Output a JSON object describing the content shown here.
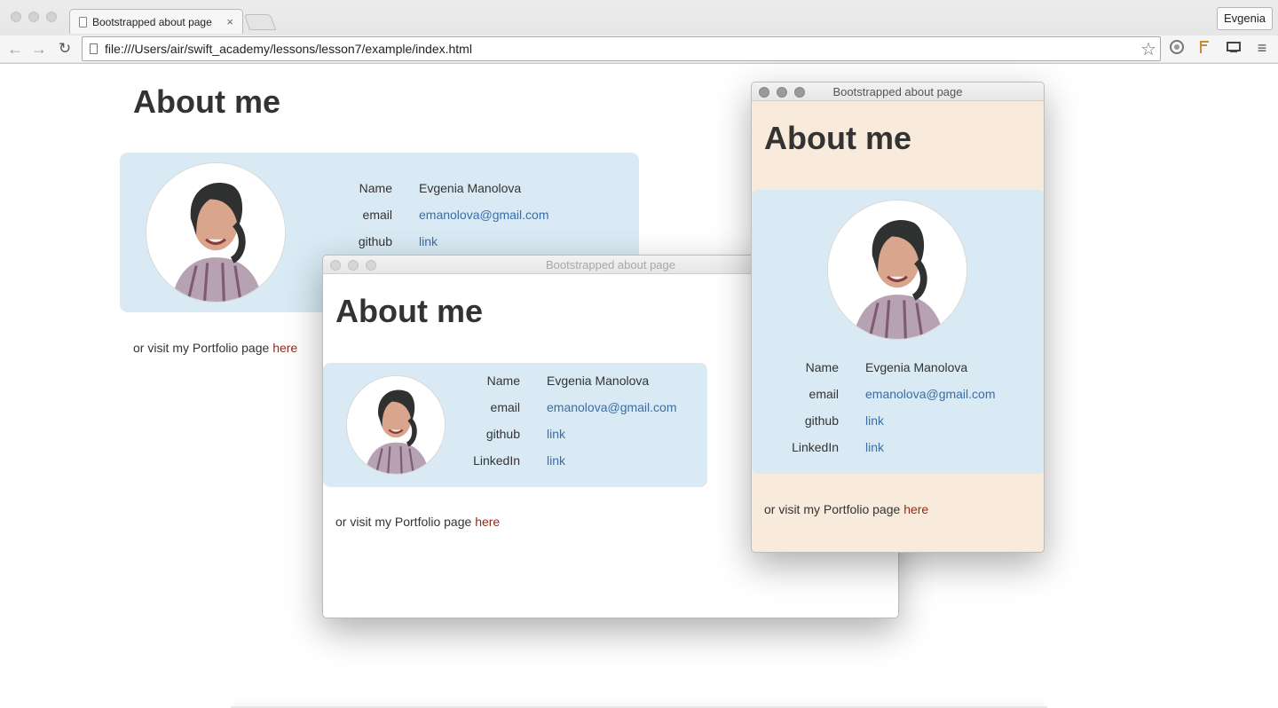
{
  "browser": {
    "tab_title": "Bootstrapped about page",
    "tab_close": "×",
    "profile_name": "Evgenia",
    "url": "file:///Users/air/swift_academy/lessons/lesson7/example/index.html",
    "back_icon": "←",
    "forward_icon": "→",
    "reload_icon": "↻",
    "star_icon": "☆",
    "menu_icon": "≡"
  },
  "page": {
    "title": "About me",
    "labels": {
      "name": "Name",
      "email": "email",
      "github": "github",
      "linkedin": "LinkedIn"
    },
    "values": {
      "name": "Evgenia Manolova",
      "email": "emanolova@gmail.com",
      "github": "link",
      "linkedin": "link"
    },
    "portfolio_text": "or visit my Portfolio page",
    "portfolio_link": "here"
  },
  "windows": {
    "popup_title": "Bootstrapped about page"
  },
  "colors": {
    "card_bg": "#d9eaf4",
    "beige_bg": "#f9ebdb",
    "link": "#3a6da5",
    "here_link": "#8b2d1e"
  }
}
